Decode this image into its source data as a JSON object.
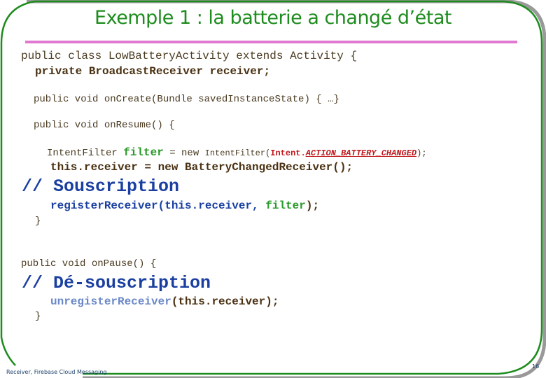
{
  "slide": {
    "title": "Exemple 1 : la batterie a changé d’état",
    "footer_text": "Receiver, Firebase Cloud Messaging",
    "page_number": "16",
    "colors": {
      "frame": "#1e8c1e",
      "title": "#1e8c1e",
      "rule": "#e07ad0",
      "comment": "#1a3fa0",
      "constant": "#c0181c",
      "variable": "#2a9a2a"
    }
  },
  "code": {
    "line1": "public class LowBatteryActivity extends Activity {",
    "line2": "private BroadcastReceiver receiver;",
    "line3": "public void onCreate(Bundle savedInstanceState) { …}",
    "line4": "public void onResume() {",
    "line5_type": "IntentFilter ",
    "line5_var": "filter",
    "line5_mid": " = new ",
    "line5_ctor": "IntentFilter(",
    "line5_intent": "Intent.",
    "line5_const": "ACTION_BATTERY_CHANGED",
    "line5_end": ");",
    "line6": "this.receiver = new BatteryChangedReceiver();",
    "comment1": "// Souscription",
    "line7_call": "registerReceiver(this.receiver, ",
    "line7_var": "filter",
    "line7_end": ");",
    "close1": "}",
    "line8": "public void onPause() {",
    "comment2": "// Dé-souscription",
    "line9_call": "unregisterReceiver",
    "line9_args": "(this.receiver);",
    "close2": "}"
  }
}
